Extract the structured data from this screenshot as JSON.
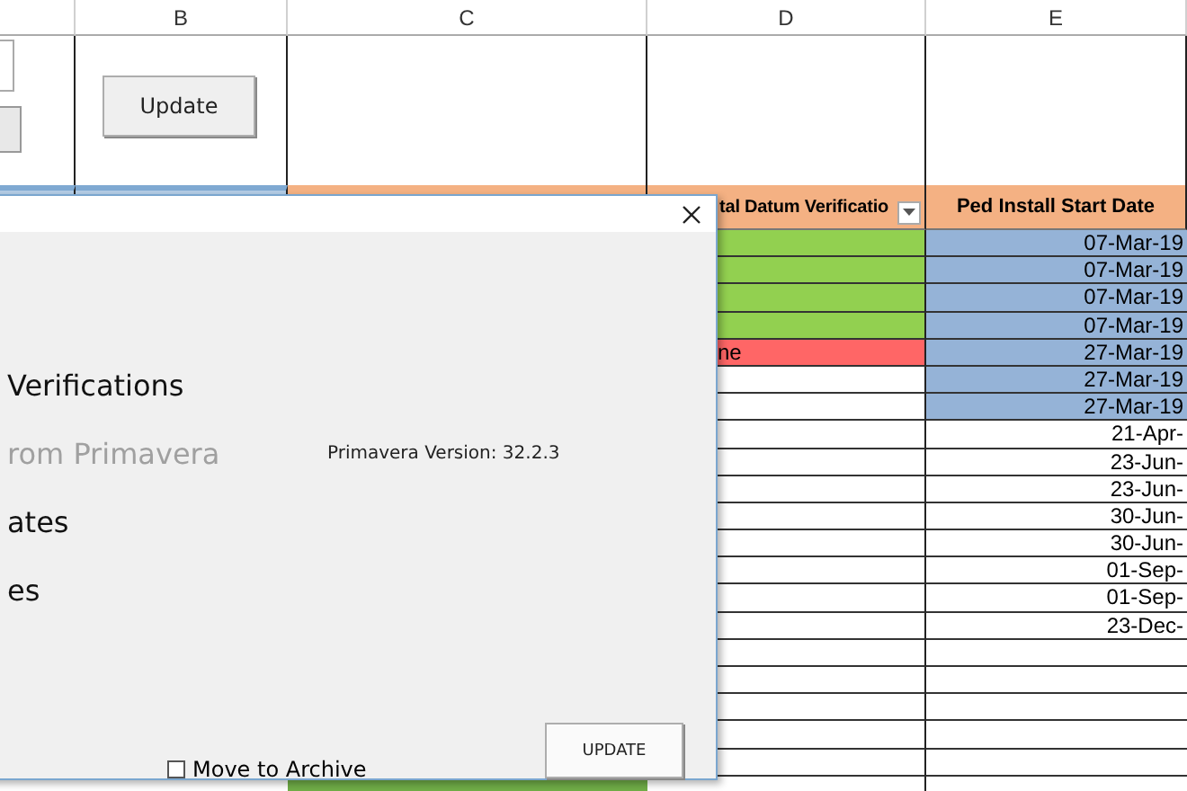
{
  "column_headers": [
    "B",
    "C",
    "D",
    "E"
  ],
  "sheet_button": "Update",
  "table": {
    "header_d": {
      "label": "tal Datum Verificatio",
      "filter": true
    },
    "header_e": {
      "label": "Ped Install Start Date"
    },
    "rows": [
      {
        "d": {
          "color": "#92d050"
        },
        "e": {
          "text": "07-Mar-19",
          "color": "#95b3d7"
        }
      },
      {
        "d": {
          "color": "#92d050"
        },
        "e": {
          "text": "07-Mar-19",
          "color": "#95b3d7"
        }
      },
      {
        "d": {
          "color": "#92d050"
        },
        "e": {
          "text": "07-Mar-19",
          "color": "#95b3d7"
        }
      },
      {
        "d": {
          "color": "#92d050"
        },
        "e": {
          "text": "07-Mar-19",
          "color": "#95b3d7"
        }
      },
      {
        "d": {
          "text": "ne",
          "color": "#ff6666"
        },
        "e": {
          "text": "27-Mar-19",
          "color": "#95b3d7"
        }
      },
      {
        "d": {},
        "e": {
          "text": "27-Mar-19",
          "color": "#95b3d7"
        }
      },
      {
        "d": {},
        "e": {
          "text": "27-Mar-19",
          "color": "#95b3d7"
        }
      },
      {
        "d": {},
        "e": {
          "text": "21-Apr-"
        }
      },
      {
        "d": {},
        "e": {
          "text": "23-Jun-"
        }
      },
      {
        "d": {},
        "e": {
          "text": "23-Jun-"
        }
      },
      {
        "d": {},
        "e": {
          "text": "30-Jun-"
        }
      },
      {
        "d": {},
        "e": {
          "text": "30-Jun-"
        }
      },
      {
        "d": {},
        "e": {
          "text": "01-Sep-"
        }
      },
      {
        "d": {},
        "e": {
          "text": "01-Sep-"
        }
      },
      {
        "d": {},
        "e": {
          "text": "23-Dec-"
        }
      },
      {
        "d": {},
        "e": {}
      },
      {
        "d": {},
        "e": {}
      },
      {
        "d": {},
        "e": {}
      },
      {
        "d": {},
        "e": {}
      },
      {
        "d": {},
        "e": {}
      },
      {
        "c": {
          "color": "#70ad47"
        },
        "d": {},
        "e": {}
      }
    ]
  },
  "dialog": {
    "menu": [
      {
        "label": "Verifications",
        "disabled": false
      },
      {
        "label": "rom Primavera",
        "disabled": true
      },
      {
        "label": "ates",
        "disabled": false
      },
      {
        "label": "es",
        "disabled": false
      }
    ],
    "version": "Primavera Version: 32.2.3",
    "archive": {
      "label": "Move to Archive",
      "checked": false
    },
    "button": "UPDATE"
  }
}
